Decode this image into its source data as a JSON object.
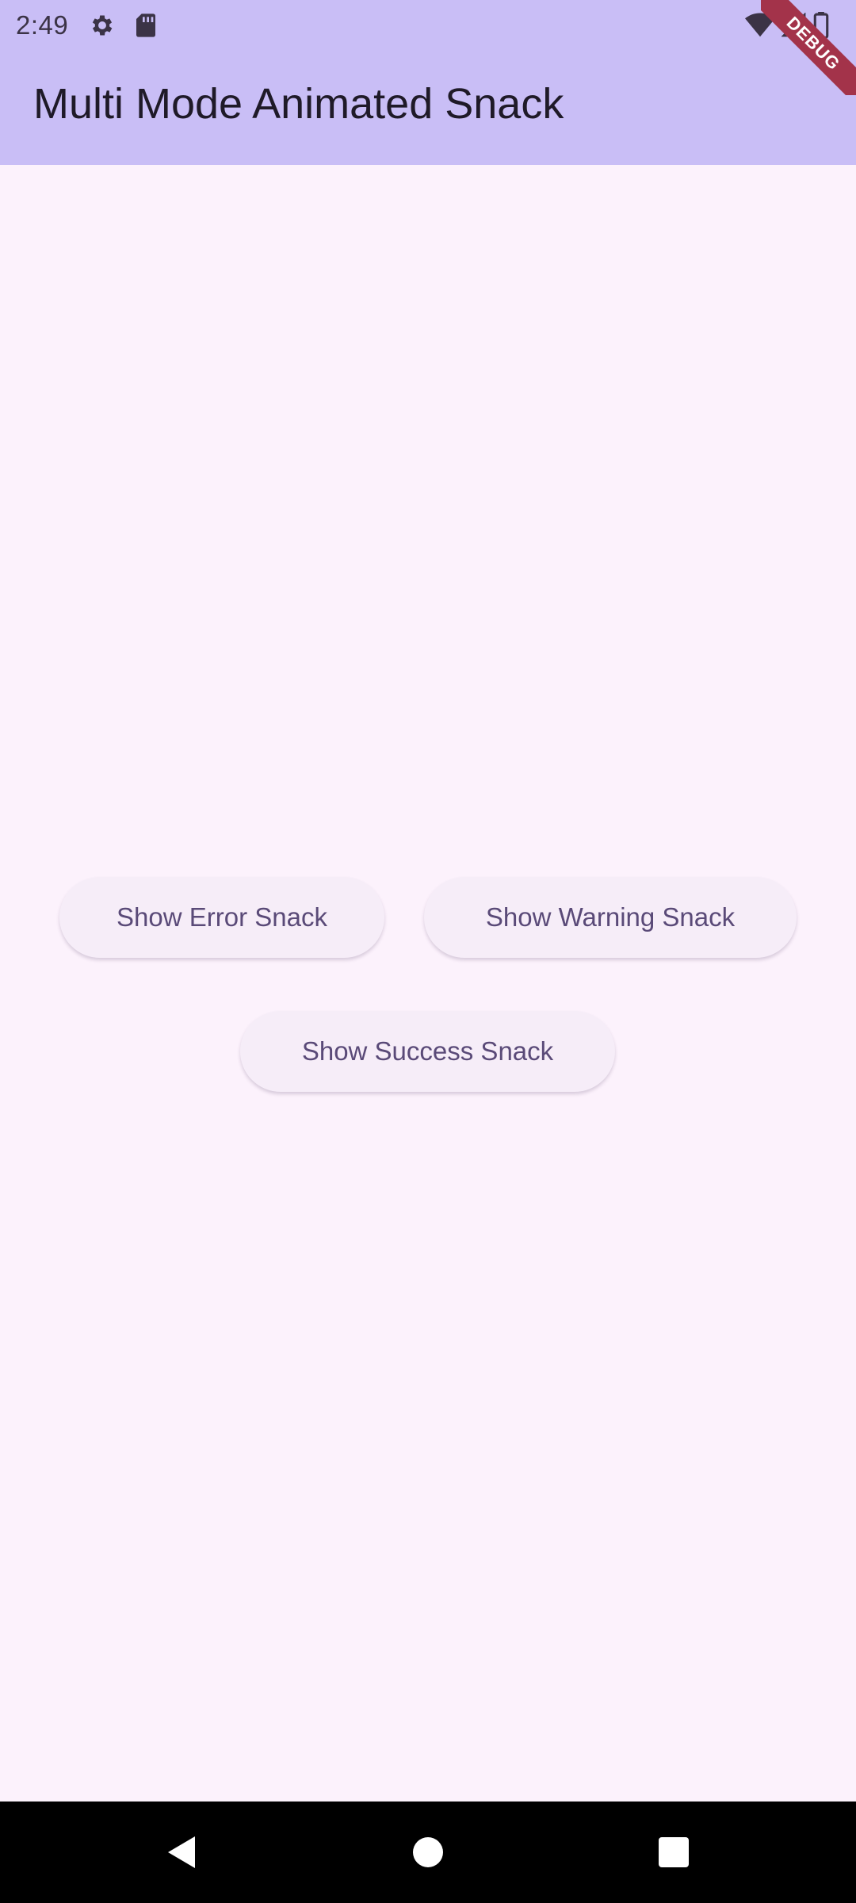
{
  "status_bar": {
    "time": "2:49",
    "icons": [
      "settings-gear-icon",
      "sd-card-icon",
      "wifi-icon",
      "cell-signal-icon",
      "battery-icon"
    ]
  },
  "app_bar": {
    "title": "Multi Mode Animated Snack",
    "background_color": "#c9bef6"
  },
  "debug_banner": {
    "label": "DEBUG",
    "color": "#a3334a"
  },
  "buttons": {
    "error": "Show Error Snack",
    "warning": "Show Warning Snack",
    "success": "Show Success Snack"
  },
  "nav_bar": {
    "icons": [
      "back-icon",
      "home-icon",
      "recents-icon"
    ]
  },
  "colors": {
    "page_background": "#fcf2fc",
    "button_background": "#f6edf8",
    "button_text": "#5a4a78"
  }
}
